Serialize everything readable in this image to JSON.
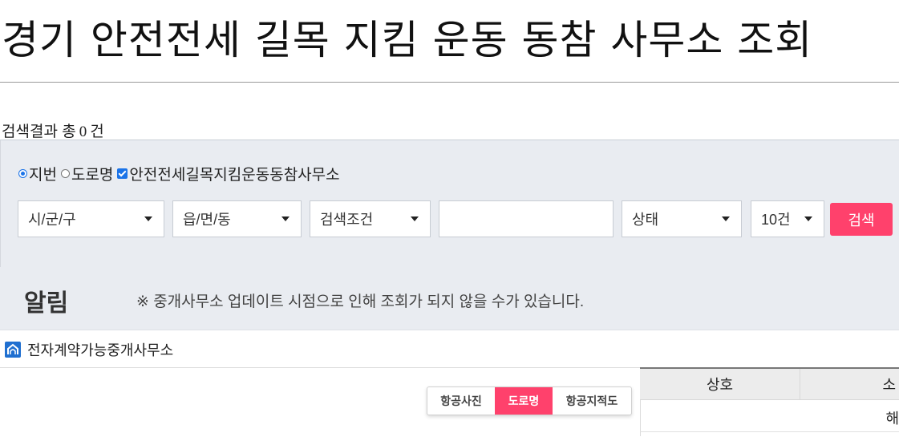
{
  "page": {
    "title": "경기 안전전세 길목 지킴 운동 동참 사무소 조회"
  },
  "results": {
    "prefix": "검색결과 총",
    "count": "0",
    "suffix": "건"
  },
  "options": [
    {
      "label": "지번",
      "type": "radio",
      "checked": true
    },
    {
      "label": "도로명",
      "type": "radio",
      "checked": false
    },
    {
      "label": "안전전세길목지킴운동동참사무소",
      "type": "checkbox",
      "checked": true
    }
  ],
  "filters": {
    "sigungu": "시/군/구",
    "eupmyeondong": "읍/면/동",
    "condition": "검색조건",
    "keyword_value": "",
    "status": "상태",
    "page_size": "10건",
    "search_button": "검색"
  },
  "notice": {
    "title": "알림",
    "text": "※ 중개사무소 업데이트 시점으로 인해 조회가 되지 않을 수가 있습니다."
  },
  "legend": {
    "label": "전자계약가능중개사무소",
    "icon": "home-icon"
  },
  "map_toggle": [
    {
      "label": "항공사진",
      "active": false
    },
    {
      "label": "도로명",
      "active": true
    },
    {
      "label": "항공지적도",
      "active": false
    }
  ],
  "table": {
    "headers": [
      "상호",
      "소"
    ],
    "empty_message": "해"
  },
  "colors": {
    "accent": "#ff416c",
    "checkbox": "#1a73e8",
    "panel": "#e9ecf1"
  }
}
